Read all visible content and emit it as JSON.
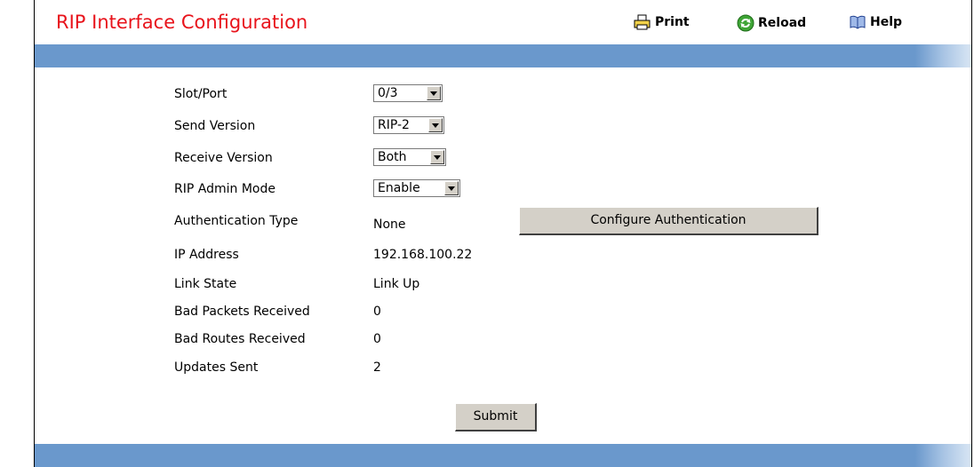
{
  "header": {
    "title": "RIP Interface Configuration",
    "print_label": "Print",
    "reload_label": "Reload",
    "help_label": "Help"
  },
  "form": {
    "slot_port": {
      "label": "Slot/Port",
      "value": "0/3"
    },
    "send_version": {
      "label": "Send Version",
      "value": "RIP-2"
    },
    "receive_version": {
      "label": "Receive Version",
      "value": "Both"
    },
    "admin_mode": {
      "label": "RIP Admin Mode",
      "value": "Enable"
    },
    "auth_type": {
      "label": "Authentication Type",
      "value": "None"
    },
    "configure_auth_label": "Configure Authentication",
    "ip_address": {
      "label": "IP Address",
      "value": "192.168.100.22"
    },
    "link_state": {
      "label": "Link State",
      "value": "Link Up"
    },
    "bad_packets": {
      "label": "Bad Packets Received",
      "value": "0"
    },
    "bad_routes": {
      "label": "Bad Routes Received",
      "value": "0"
    },
    "updates_sent": {
      "label": "Updates Sent",
      "value": "2"
    },
    "submit_label": "Submit"
  },
  "colors": {
    "title": "#e8131b",
    "bar": "#6a98cc",
    "button_face": "#d4d0c8"
  },
  "icons": {
    "print": "printer-icon",
    "reload": "reload-icon",
    "help": "help-book-icon"
  }
}
